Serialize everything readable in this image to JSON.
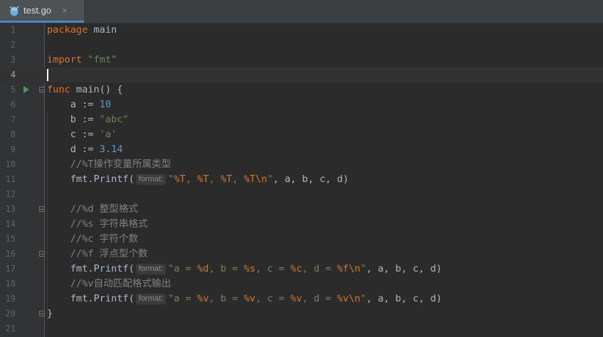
{
  "tab": {
    "label": "test.go",
    "close_glyph": "×",
    "icon": "go-gopher-icon"
  },
  "accent": "#4a88c7",
  "hint_label": "format:",
  "lines": [
    {
      "n": "1",
      "segs": [
        [
          "kw",
          "package "
        ],
        [
          "id",
          "main"
        ]
      ]
    },
    {
      "n": "2",
      "segs": []
    },
    {
      "n": "3",
      "segs": [
        [
          "kw",
          "import "
        ],
        [
          "str",
          "\"fmt\""
        ]
      ]
    },
    {
      "n": "4",
      "segs": [],
      "current": true
    },
    {
      "n": "5",
      "segs": [
        [
          "kw",
          "func "
        ],
        [
          "id",
          "main() {"
        ]
      ],
      "run": true,
      "fold": true
    },
    {
      "n": "6",
      "segs": [
        [
          "id",
          "    a := "
        ],
        [
          "num",
          "10"
        ]
      ]
    },
    {
      "n": "7",
      "segs": [
        [
          "id",
          "    b := "
        ],
        [
          "str",
          "\"abc\""
        ]
      ]
    },
    {
      "n": "8",
      "segs": [
        [
          "id",
          "    c := "
        ],
        [
          "str",
          "'a'"
        ]
      ]
    },
    {
      "n": "9",
      "segs": [
        [
          "id",
          "    d := "
        ],
        [
          "num",
          "3.14"
        ]
      ]
    },
    {
      "n": "10",
      "segs": [
        [
          "cmt",
          "    //%T操作变量所属类型"
        ]
      ]
    },
    {
      "n": "11",
      "segs": [
        [
          "id",
          "    fmt.Printf("
        ],
        [
          "hint",
          "format:"
        ],
        [
          "str",
          "\""
        ],
        [
          "fmt",
          "%T"
        ],
        [
          "str",
          ", "
        ],
        [
          "fmt",
          "%T"
        ],
        [
          "str",
          ", "
        ],
        [
          "fmt",
          "%T"
        ],
        [
          "str",
          ", "
        ],
        [
          "fmt",
          "%T\\n"
        ],
        [
          "str",
          "\""
        ],
        [
          "id",
          ", a, b, c, d)"
        ]
      ]
    },
    {
      "n": "12",
      "segs": []
    },
    {
      "n": "13",
      "segs": [
        [
          "cmt",
          "    //%d 整型格式"
        ]
      ],
      "fold": true
    },
    {
      "n": "14",
      "segs": [
        [
          "cmt",
          "    //%s 字符串格式"
        ]
      ]
    },
    {
      "n": "15",
      "segs": [
        [
          "cmt",
          "    //%c 字符个数"
        ]
      ]
    },
    {
      "n": "16",
      "segs": [
        [
          "cmt",
          "    //%f 浮点型个数"
        ]
      ],
      "fold": true
    },
    {
      "n": "17",
      "segs": [
        [
          "id",
          "    fmt.Printf("
        ],
        [
          "hint",
          "format:"
        ],
        [
          "str",
          "\"a = "
        ],
        [
          "fmt",
          "%d"
        ],
        [
          "str",
          ", b = "
        ],
        [
          "fmt",
          "%s"
        ],
        [
          "str",
          ", c = "
        ],
        [
          "fmt",
          "%c"
        ],
        [
          "str",
          ", d = "
        ],
        [
          "fmt",
          "%f\\n"
        ],
        [
          "str",
          "\""
        ],
        [
          "id",
          ", a, b, c, d)"
        ]
      ]
    },
    {
      "n": "18",
      "segs": [
        [
          "cmt",
          "    //%v自动匹配格式输出"
        ]
      ]
    },
    {
      "n": "19",
      "segs": [
        [
          "id",
          "    fmt.Printf("
        ],
        [
          "hint",
          "format:"
        ],
        [
          "str",
          "\"a = "
        ],
        [
          "fmt",
          "%v"
        ],
        [
          "str",
          ", b = "
        ],
        [
          "fmt",
          "%v"
        ],
        [
          "str",
          ", c = "
        ],
        [
          "fmt",
          "%v"
        ],
        [
          "str",
          ", d = "
        ],
        [
          "fmt",
          "%v\\n"
        ],
        [
          "str",
          "\""
        ],
        [
          "id",
          ", a, b, c, d)"
        ]
      ]
    },
    {
      "n": "20",
      "segs": [
        [
          "id",
          "}"
        ]
      ],
      "fold": true
    },
    {
      "n": "21",
      "segs": []
    }
  ]
}
